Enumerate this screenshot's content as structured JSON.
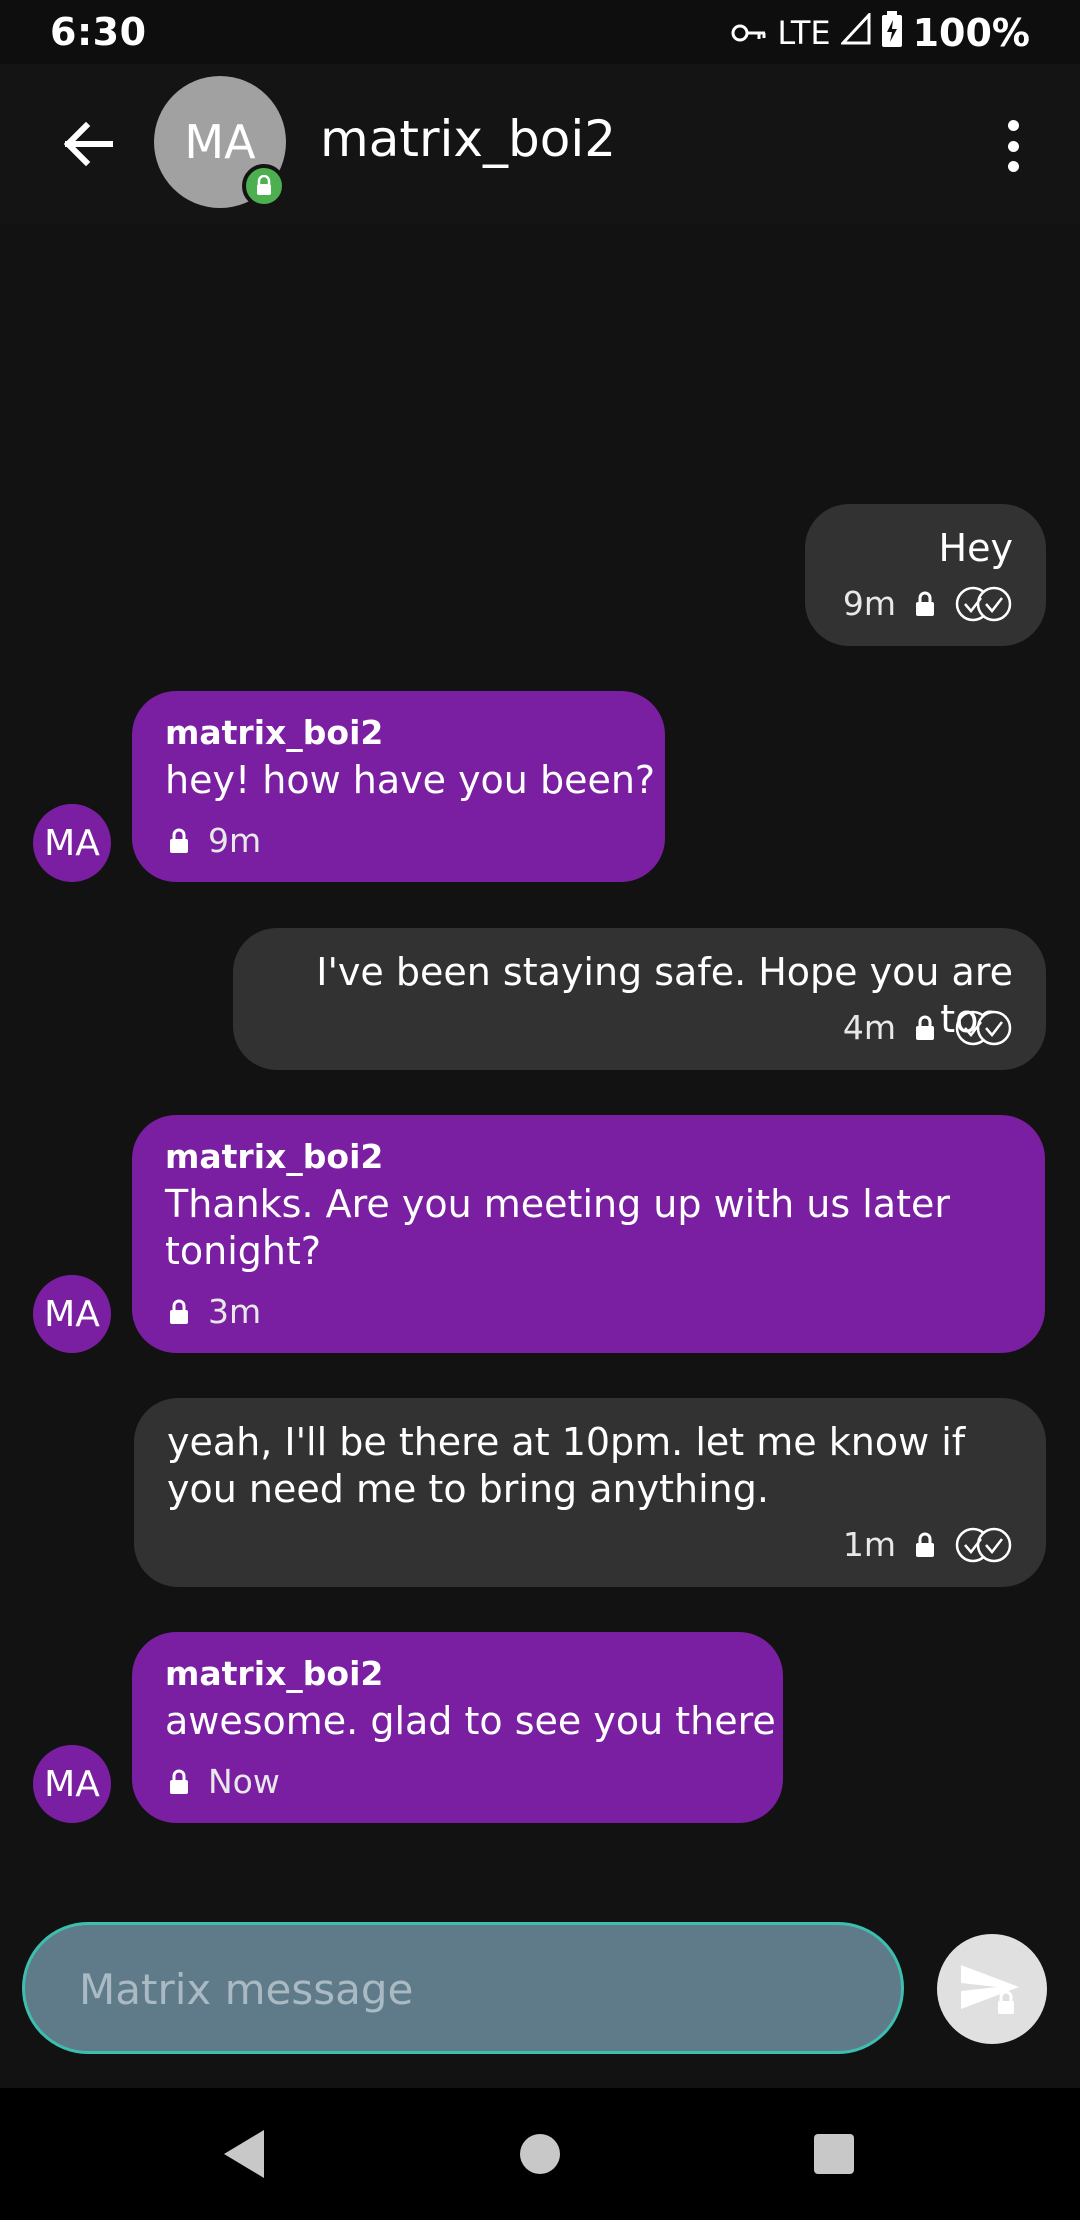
{
  "status_bar": {
    "time": "6:30",
    "network": "LTE",
    "battery": "100%"
  },
  "header": {
    "avatar_initials": "MA",
    "contact_name": "matrix_boi2",
    "icons": [
      "back-arrow-icon",
      "lock-icon",
      "more-vert-icon"
    ]
  },
  "messages": [
    {
      "direction": "outgoing",
      "text": "Hey",
      "time": "9m",
      "status": "delivered"
    },
    {
      "direction": "incoming",
      "sender": "matrix_boi2",
      "avatar": "MA",
      "text": "hey! how have you been?",
      "time": "9m"
    },
    {
      "direction": "outgoing",
      "text": "I've been staying safe. Hope you are too.",
      "time": "4m",
      "status": "delivered"
    },
    {
      "direction": "incoming",
      "sender": "matrix_boi2",
      "avatar": "MA",
      "text": "Thanks. Are you meeting up with us later tonight?",
      "time": "3m"
    },
    {
      "direction": "outgoing",
      "text": "yeah, I'll be there at 10pm. let me know if you need me to bring anything.",
      "time": "1m",
      "status": "delivered"
    },
    {
      "direction": "incoming",
      "sender": "matrix_boi2",
      "avatar": "MA",
      "text": "awesome. glad to see you there",
      "time": "Now"
    }
  ],
  "composer": {
    "placeholder": "Matrix message",
    "value": ""
  },
  "colors": {
    "background": "#121213",
    "incoming_bubble": "#7b1fa2",
    "outgoing_bubble": "#323233",
    "composer_fill": "#5f7b8a",
    "composer_border": "#3cbfae",
    "lock_badge": "#4caf50"
  }
}
